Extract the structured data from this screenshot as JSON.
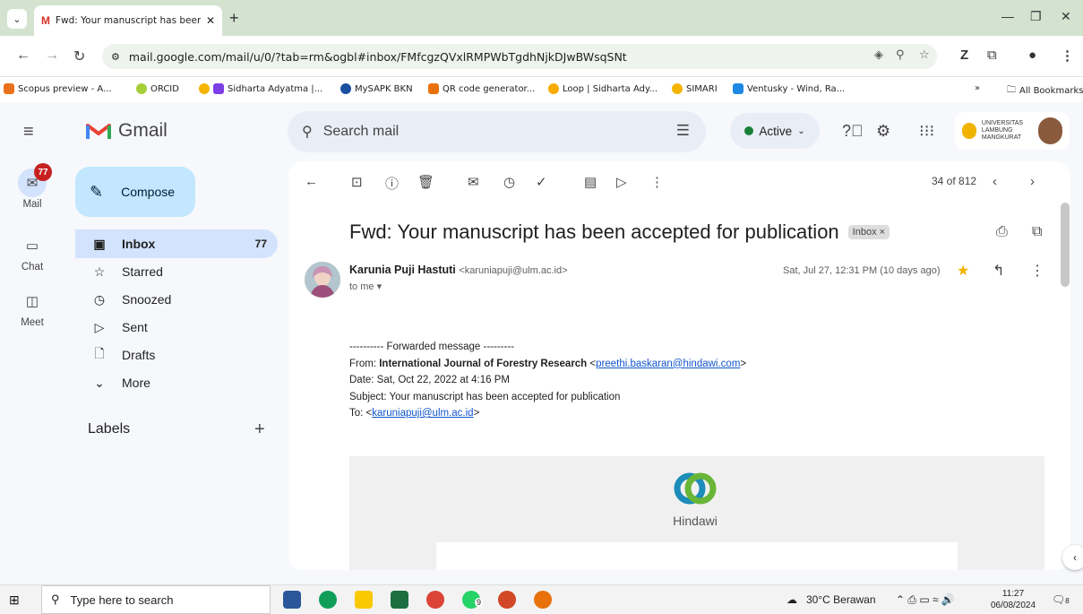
{
  "browser": {
    "tab_title": "Fwd: Your manuscript has been",
    "address": "mail.google.com/mail/u/0/?tab=rm&ogbl#inbox/FMfcgzQVxlRMPWbTgdhNjkDJwBWsqSNt",
    "bookmarks": [
      "Scopus preview - A...",
      "ORCID",
      "Sidharta Adyatma |...",
      "MySAPK BKN",
      "QR code generator...",
      "Loop | Sidharta Ady...",
      "SIMARI",
      "Ventusky - Wind, Ra..."
    ],
    "all_bookmarks": "All Bookmarks",
    "bookmarks_overflow": "»"
  },
  "gmail": {
    "brand": "Gmail",
    "search_placeholder": "Search mail",
    "status": "Active",
    "account_text": "UNIVERSITAS LAMBUNG MANGKURAT"
  },
  "rail": {
    "mail_label": "Mail",
    "mail_badge": "77",
    "chat_label": "Chat",
    "meet_label": "Meet"
  },
  "nav": {
    "compose": "Compose",
    "items": [
      {
        "label": "Inbox",
        "count": "77"
      },
      {
        "label": "Starred"
      },
      {
        "label": "Snoozed"
      },
      {
        "label": "Sent"
      },
      {
        "label": "Drafts"
      },
      {
        "label": "More"
      }
    ],
    "labels_heading": "Labels"
  },
  "message": {
    "pager": "34 of 812",
    "subject": "Fwd: Your manuscript has been accepted for publication",
    "chip": "Inbox ×",
    "sender_name": "Karunia Puji Hastuti",
    "sender_email": "<karuniapuji@ulm.ac.id>",
    "to": "to me ▾",
    "date": "Sat, Jul 27, 12:31 PM (10 days ago)",
    "body": {
      "forward_line": "---------- Forwarded message ---------",
      "from_prefix": "From: ",
      "from_name": "International Journal of Forestry Research",
      "from_email": "preethi.baskaran@hindawi.com",
      "date_line": "Date: Sat, Oct 22, 2022 at 4:16 PM",
      "subject_line": "Subject: Your manuscript has been accepted for publication",
      "to_prefix": "To: <",
      "to_email": "karuniapuji@ulm.ac.id",
      "to_suffix": ">"
    },
    "hindawi_name": "Hindawi"
  },
  "taskbar": {
    "search_placeholder": "Type here to search",
    "weather": "30°C  Berawan",
    "time": "11:27",
    "date": "06/08/2024",
    "notif_count": "8",
    "whatsapp_badge": "9"
  },
  "colors": {
    "tabstrip": "#d3e3d0",
    "compose": "#c2e7ff",
    "selected_nav": "#d3e3fd",
    "badge": "#c5221f",
    "link": "#1155cc"
  }
}
